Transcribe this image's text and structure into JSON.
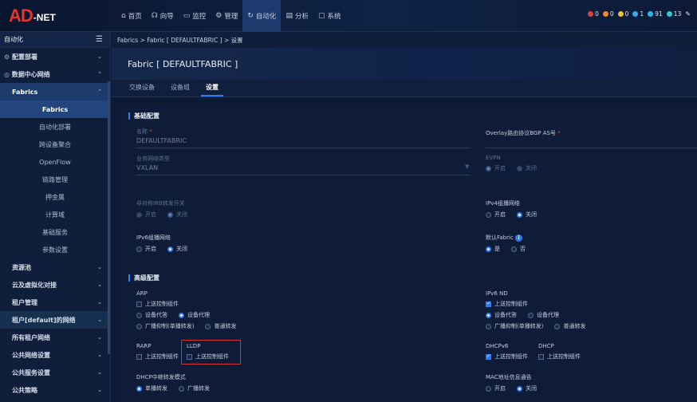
{
  "logo": {
    "big": "AD",
    "net": "-NET"
  },
  "nav": [
    {
      "icon": "⌂",
      "label": "首页"
    },
    {
      "icon": "☊",
      "label": "向导"
    },
    {
      "icon": "▭",
      "label": "监控"
    },
    {
      "icon": "⚙",
      "label": "管理"
    },
    {
      "icon": "↻",
      "label": "自动化"
    },
    {
      "icon": "▤",
      "label": "分析"
    },
    {
      "icon": "▢",
      "label": "系统"
    }
  ],
  "status": [
    {
      "color": "#e2403b",
      "count": "0"
    },
    {
      "color": "#f08a2c",
      "count": "0"
    },
    {
      "color": "#e7c12c",
      "count": "0"
    },
    {
      "color": "#35a8ee",
      "count": "1"
    },
    {
      "color": "#2fb3e6",
      "count": "91"
    },
    {
      "color": "#36c8c8",
      "count": "13"
    }
  ],
  "sidebar": {
    "header": "自动化",
    "items": [
      "配置部署",
      "数据中心网络",
      "Fabrics",
      "Fabrics",
      "自动化部署",
      "跨设备聚合",
      "OpenFlow",
      "链路管理",
      "押金属",
      "计算域",
      "基础服务",
      "参数设置",
      "资源池",
      "云及虚拟化对接",
      "租户管理",
      "租户[default]的网络",
      "所有租户网络",
      "公共网络设置",
      "公共服务设置",
      "公共策略"
    ]
  },
  "breadcrumb": "Fabrics > Fabric [ DEFAULTFABRIC ] > 设置",
  "title": "Fabric [ DEFAULTFABRIC ]",
  "tabs": [
    "交换设备",
    "设备组",
    "设置"
  ],
  "sections": {
    "basic": "基础配置",
    "advanced": "高级配置"
  },
  "basic": {
    "name_label": "名称",
    "name_value": "DEFAULTFABRIC",
    "bgp_label": "Overlay路由协议BGP AS号",
    "nettype_label": "业务网络类型",
    "nettype_value": "VXLAN",
    "evpn_label": "EVPN",
    "evpn_on": "开启",
    "evpn_off": "关闭",
    "irb_label": "非对称IRB转发开关",
    "irb_on": "开启",
    "irb_off": "关闭",
    "ipv4_label": "IPv4组播网络",
    "ipv4_on": "开启",
    "ipv4_off": "关闭",
    "ipv6_label": "IPv6组播网络",
    "ipv6_on": "开启",
    "ipv6_off": "关闭",
    "default_label": "默认Fabric",
    "default_yes": "是",
    "default_no": "否"
  },
  "advanced": {
    "arp_label": "ARP",
    "arp_report": "上送控制组件",
    "arp_agent": "设备代答",
    "arp_proxy": "设备代理",
    "arp_bcast": "广播抑制(单播转发)",
    "arp_normal": "普通转发",
    "nd_label": "IPv6 ND",
    "nd_report": "上送控制组件",
    "nd_agent": "设备代答",
    "nd_proxy": "设备代理",
    "nd_bcast": "广播抑制(单播转发)",
    "nd_normal": "普通转发",
    "rarp_label": "RARP",
    "rarp_report": "上送控制组件",
    "lldp_label": "LLDP",
    "lldp_report": "上送控制组件",
    "dhcpv6_label": "DHCPv6",
    "dhcpv6_report": "上送控制组件",
    "dhcp_label": "DHCP",
    "dhcp_report": "上送控制组件",
    "relay_label": "DHCP中继转发模式",
    "relay_unicast": "单播转发",
    "relay_broadcast": "广播转发",
    "mac_label": "MAC地址信息通告",
    "mac_on": "开启",
    "mac_off": "关闭"
  }
}
